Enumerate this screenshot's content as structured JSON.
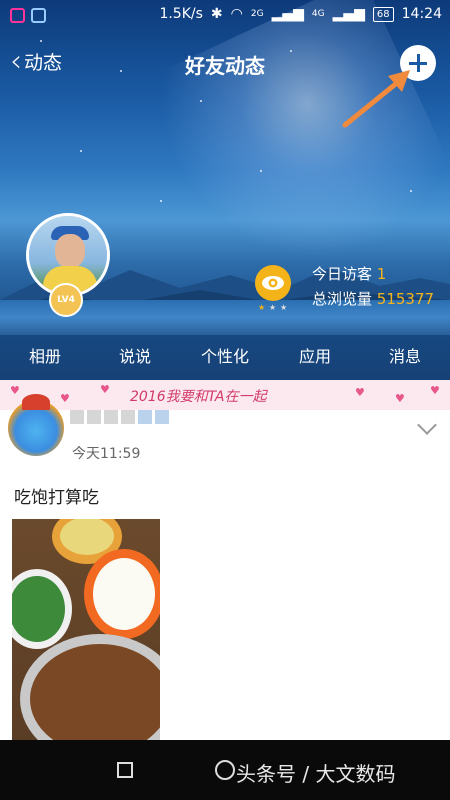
{
  "status_bar": {
    "speed": "1.5K/s",
    "signal1": "2G",
    "signal2": "4G",
    "battery": "68",
    "time": "14:24"
  },
  "nav": {
    "back_label": "动态",
    "title": "好友动态",
    "add_icon": "plus-icon"
  },
  "profile": {
    "level": "LV4",
    "today_visitors_label": "今日访客",
    "today_visitors_value": "1",
    "total_views_label": "总浏览量",
    "total_views_value": "515377"
  },
  "tabs": [
    {
      "label": "相册"
    },
    {
      "label": "说说"
    },
    {
      "label": "个性化"
    },
    {
      "label": "应用"
    },
    {
      "label": "消息"
    }
  ],
  "banner": {
    "text": "2016我要和TA在一起"
  },
  "post": {
    "time": "今天11:59",
    "text": "吃饱打算吃"
  },
  "system_nav": {
    "watermark": "头条号 / 大文数码"
  },
  "colors": {
    "accent": "#f5b31a",
    "arrow": "#f08a3c",
    "banner_text": "#d33a6a"
  }
}
